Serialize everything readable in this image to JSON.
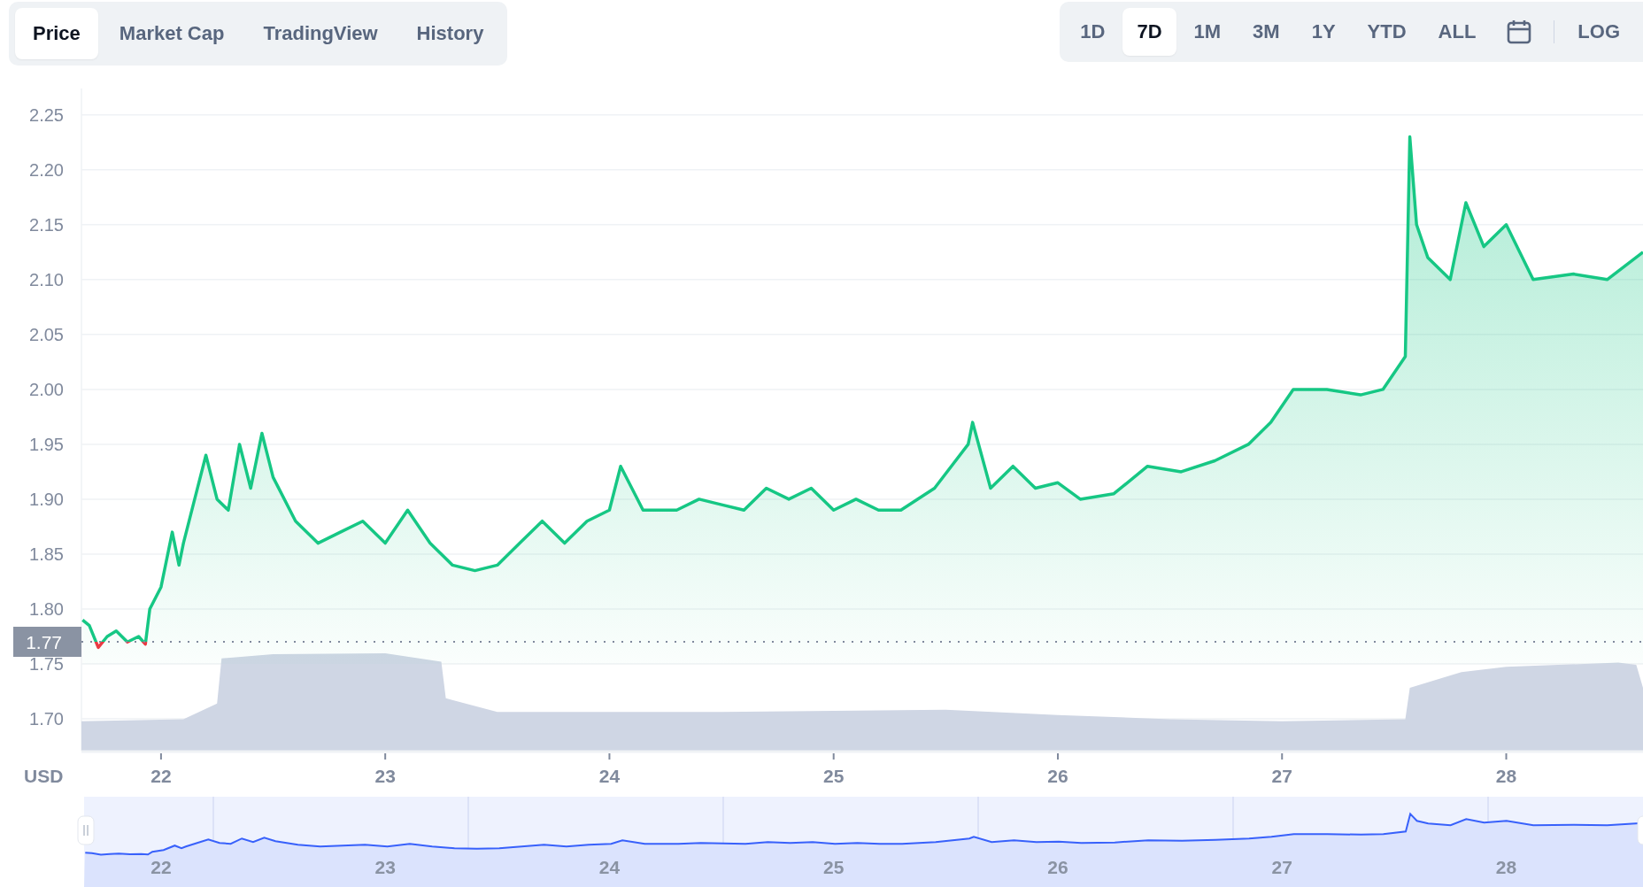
{
  "view_tabs": [
    {
      "label": "Price",
      "selected": true
    },
    {
      "label": "Market Cap",
      "selected": false
    },
    {
      "label": "TradingView",
      "selected": false
    },
    {
      "label": "History",
      "selected": false
    }
  ],
  "range_tabs": [
    {
      "label": "1D",
      "selected": false
    },
    {
      "label": "7D",
      "selected": true
    },
    {
      "label": "1M",
      "selected": false
    },
    {
      "label": "3M",
      "selected": false
    },
    {
      "label": "1Y",
      "selected": false
    },
    {
      "label": "YTD",
      "selected": false
    },
    {
      "label": "ALL",
      "selected": false
    }
  ],
  "log_button": "LOG",
  "price_chart": {
    "currency_label": "USD",
    "current_price_tag": "1.77",
    "chart_data": {
      "type": "area",
      "grid": true,
      "x": [
        21.65,
        21.68,
        21.72,
        21.76,
        21.8,
        21.85,
        21.9,
        21.93,
        21.95,
        22.0,
        22.05,
        22.08,
        22.1,
        22.15,
        22.2,
        22.25,
        22.3,
        22.35,
        22.4,
        22.45,
        22.5,
        22.6,
        22.7,
        22.8,
        22.9,
        23.0,
        23.1,
        23.2,
        23.3,
        23.4,
        23.5,
        23.6,
        23.7,
        23.8,
        23.9,
        24.0,
        24.05,
        24.15,
        24.3,
        24.4,
        24.5,
        24.6,
        24.7,
        24.8,
        24.9,
        25.0,
        25.1,
        25.2,
        25.3,
        25.45,
        25.6,
        25.62,
        25.7,
        25.8,
        25.9,
        26.0,
        26.1,
        26.25,
        26.4,
        26.55,
        26.7,
        26.85,
        26.95,
        27.05,
        27.2,
        27.35,
        27.45,
        27.55,
        27.57,
        27.6,
        27.65,
        27.75,
        27.82,
        27.9,
        28.0,
        28.12,
        28.3,
        28.45,
        28.61
      ],
      "series": [
        {
          "color": "#16c784",
          "values": [
            1.79,
            1.785,
            1.765,
            1.775,
            1.78,
            1.77,
            1.775,
            1.768,
            1.8,
            1.82,
            1.87,
            1.84,
            1.86,
            1.9,
            1.94,
            1.9,
            1.89,
            1.95,
            1.91,
            1.96,
            1.92,
            1.88,
            1.86,
            1.87,
            1.88,
            1.86,
            1.89,
            1.86,
            1.84,
            1.835,
            1.84,
            1.86,
            1.88,
            1.86,
            1.88,
            1.89,
            1.93,
            1.89,
            1.89,
            1.9,
            1.895,
            1.89,
            1.91,
            1.9,
            1.91,
            1.89,
            1.9,
            1.89,
            1.89,
            1.91,
            1.95,
            1.97,
            1.91,
            1.93,
            1.91,
            1.915,
            1.9,
            1.905,
            1.93,
            1.925,
            1.935,
            1.95,
            1.97,
            2.0,
            2.0,
            1.995,
            2.0,
            2.03,
            2.23,
            2.15,
            2.12,
            2.1,
            2.17,
            2.13,
            2.15,
            2.1,
            2.105,
            2.1,
            2.125
          ]
        }
      ],
      "xlim": [
        21.645,
        28.61
      ],
      "ylim": [
        1.671,
        2.274
      ],
      "xticks": [
        {
          "value": 22,
          "label": "22"
        },
        {
          "value": 23,
          "label": "23"
        },
        {
          "value": 24,
          "label": "24"
        },
        {
          "value": 25,
          "label": "25"
        },
        {
          "value": 26,
          "label": "26"
        },
        {
          "value": 27,
          "label": "27"
        },
        {
          "value": 28,
          "label": "28"
        }
      ],
      "yticks": [
        {
          "value": 1.7,
          "label": "1.70"
        },
        {
          "value": 1.75,
          "label": "1.75"
        },
        {
          "value": 1.8,
          "label": "1.80"
        },
        {
          "value": 1.85,
          "label": "1.85"
        },
        {
          "value": 1.9,
          "label": "1.90"
        },
        {
          "value": 1.95,
          "label": "1.95"
        },
        {
          "value": 2.0,
          "label": "2.00"
        },
        {
          "value": 2.05,
          "label": "2.05"
        },
        {
          "value": 2.1,
          "label": "2.10"
        },
        {
          "value": 2.15,
          "label": "2.15"
        },
        {
          "value": 2.2,
          "label": "2.20"
        },
        {
          "value": 2.25,
          "label": "2.25"
        }
      ]
    }
  },
  "navigator": {
    "labels": [
      "22",
      "23",
      "24",
      "25",
      "26",
      "27",
      "28"
    ]
  }
}
